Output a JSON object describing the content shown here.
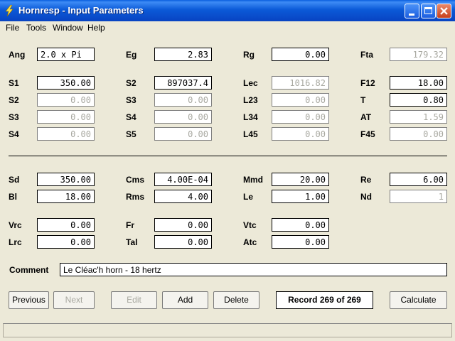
{
  "window": {
    "title": "Hornresp - Input Parameters",
    "icon": "lightning-bolt-icon"
  },
  "menu": [
    "File",
    "Tools",
    "Window",
    "Help"
  ],
  "params_top": [
    {
      "label": "Ang",
      "value": "2.0 x Pi",
      "disabled": false
    },
    {
      "label": "Eg",
      "value": "2.83",
      "disabled": false
    },
    {
      "label": "Rg",
      "value": "0.00",
      "disabled": false
    },
    {
      "label": "Fta",
      "value": "179.32",
      "disabled": true
    },
    {
      "label": "S1",
      "value": "350.00",
      "disabled": false
    },
    {
      "label": "S2",
      "value": "897037.4",
      "disabled": false
    },
    {
      "label": "Lec",
      "value": "1016.82",
      "disabled": true
    },
    {
      "label": "F12",
      "value": "18.00",
      "disabled": false
    },
    {
      "label": "S2",
      "value": "0.00",
      "disabled": true
    },
    {
      "label": "S3",
      "value": "0.00",
      "disabled": true
    },
    {
      "label": "L23",
      "value": "0.00",
      "disabled": true
    },
    {
      "label": "T",
      "value": "0.80",
      "disabled": false
    },
    {
      "label": "S3",
      "value": "0.00",
      "disabled": true
    },
    {
      "label": "S4",
      "value": "0.00",
      "disabled": true
    },
    {
      "label": "L34",
      "value": "0.00",
      "disabled": true
    },
    {
      "label": "AT",
      "value": "1.59",
      "disabled": true
    },
    {
      "label": "S4",
      "value": "0.00",
      "disabled": true
    },
    {
      "label": "S5",
      "value": "0.00",
      "disabled": true
    },
    {
      "label": "L45",
      "value": "0.00",
      "disabled": true
    },
    {
      "label": "F45",
      "value": "0.00",
      "disabled": true
    }
  ],
  "params_bottom": [
    {
      "label": "Sd",
      "value": "350.00",
      "disabled": false
    },
    {
      "label": "Cms",
      "value": "4.00E-04",
      "disabled": false
    },
    {
      "label": "Mmd",
      "value": "20.00",
      "disabled": false
    },
    {
      "label": "Re",
      "value": "6.00",
      "disabled": false
    },
    {
      "label": "Bl",
      "value": "18.00",
      "disabled": false
    },
    {
      "label": "Rms",
      "value": "4.00",
      "disabled": false
    },
    {
      "label": "Le",
      "value": "1.00",
      "disabled": false
    },
    {
      "label": "Nd",
      "value": "1",
      "disabled": true
    },
    {
      "label": "Vrc",
      "value": "0.00",
      "disabled": false
    },
    {
      "label": "Fr",
      "value": "0.00",
      "disabled": false
    },
    {
      "label": "Vtc",
      "value": "0.00",
      "disabled": false
    },
    {
      "label": "Lrc",
      "value": "0.00",
      "disabled": false
    },
    {
      "label": "Tal",
      "value": "0.00",
      "disabled": false
    },
    {
      "label": "Atc",
      "value": "0.00",
      "disabled": false
    }
  ],
  "comment": {
    "label": "Comment",
    "value": "Le Cléac'h horn - 18 hertz"
  },
  "buttons": {
    "previous": "Previous",
    "next": "Next",
    "edit": "Edit",
    "add": "Add",
    "delete": "Delete",
    "calculate": "Calculate"
  },
  "record": "Record 269 of 269"
}
